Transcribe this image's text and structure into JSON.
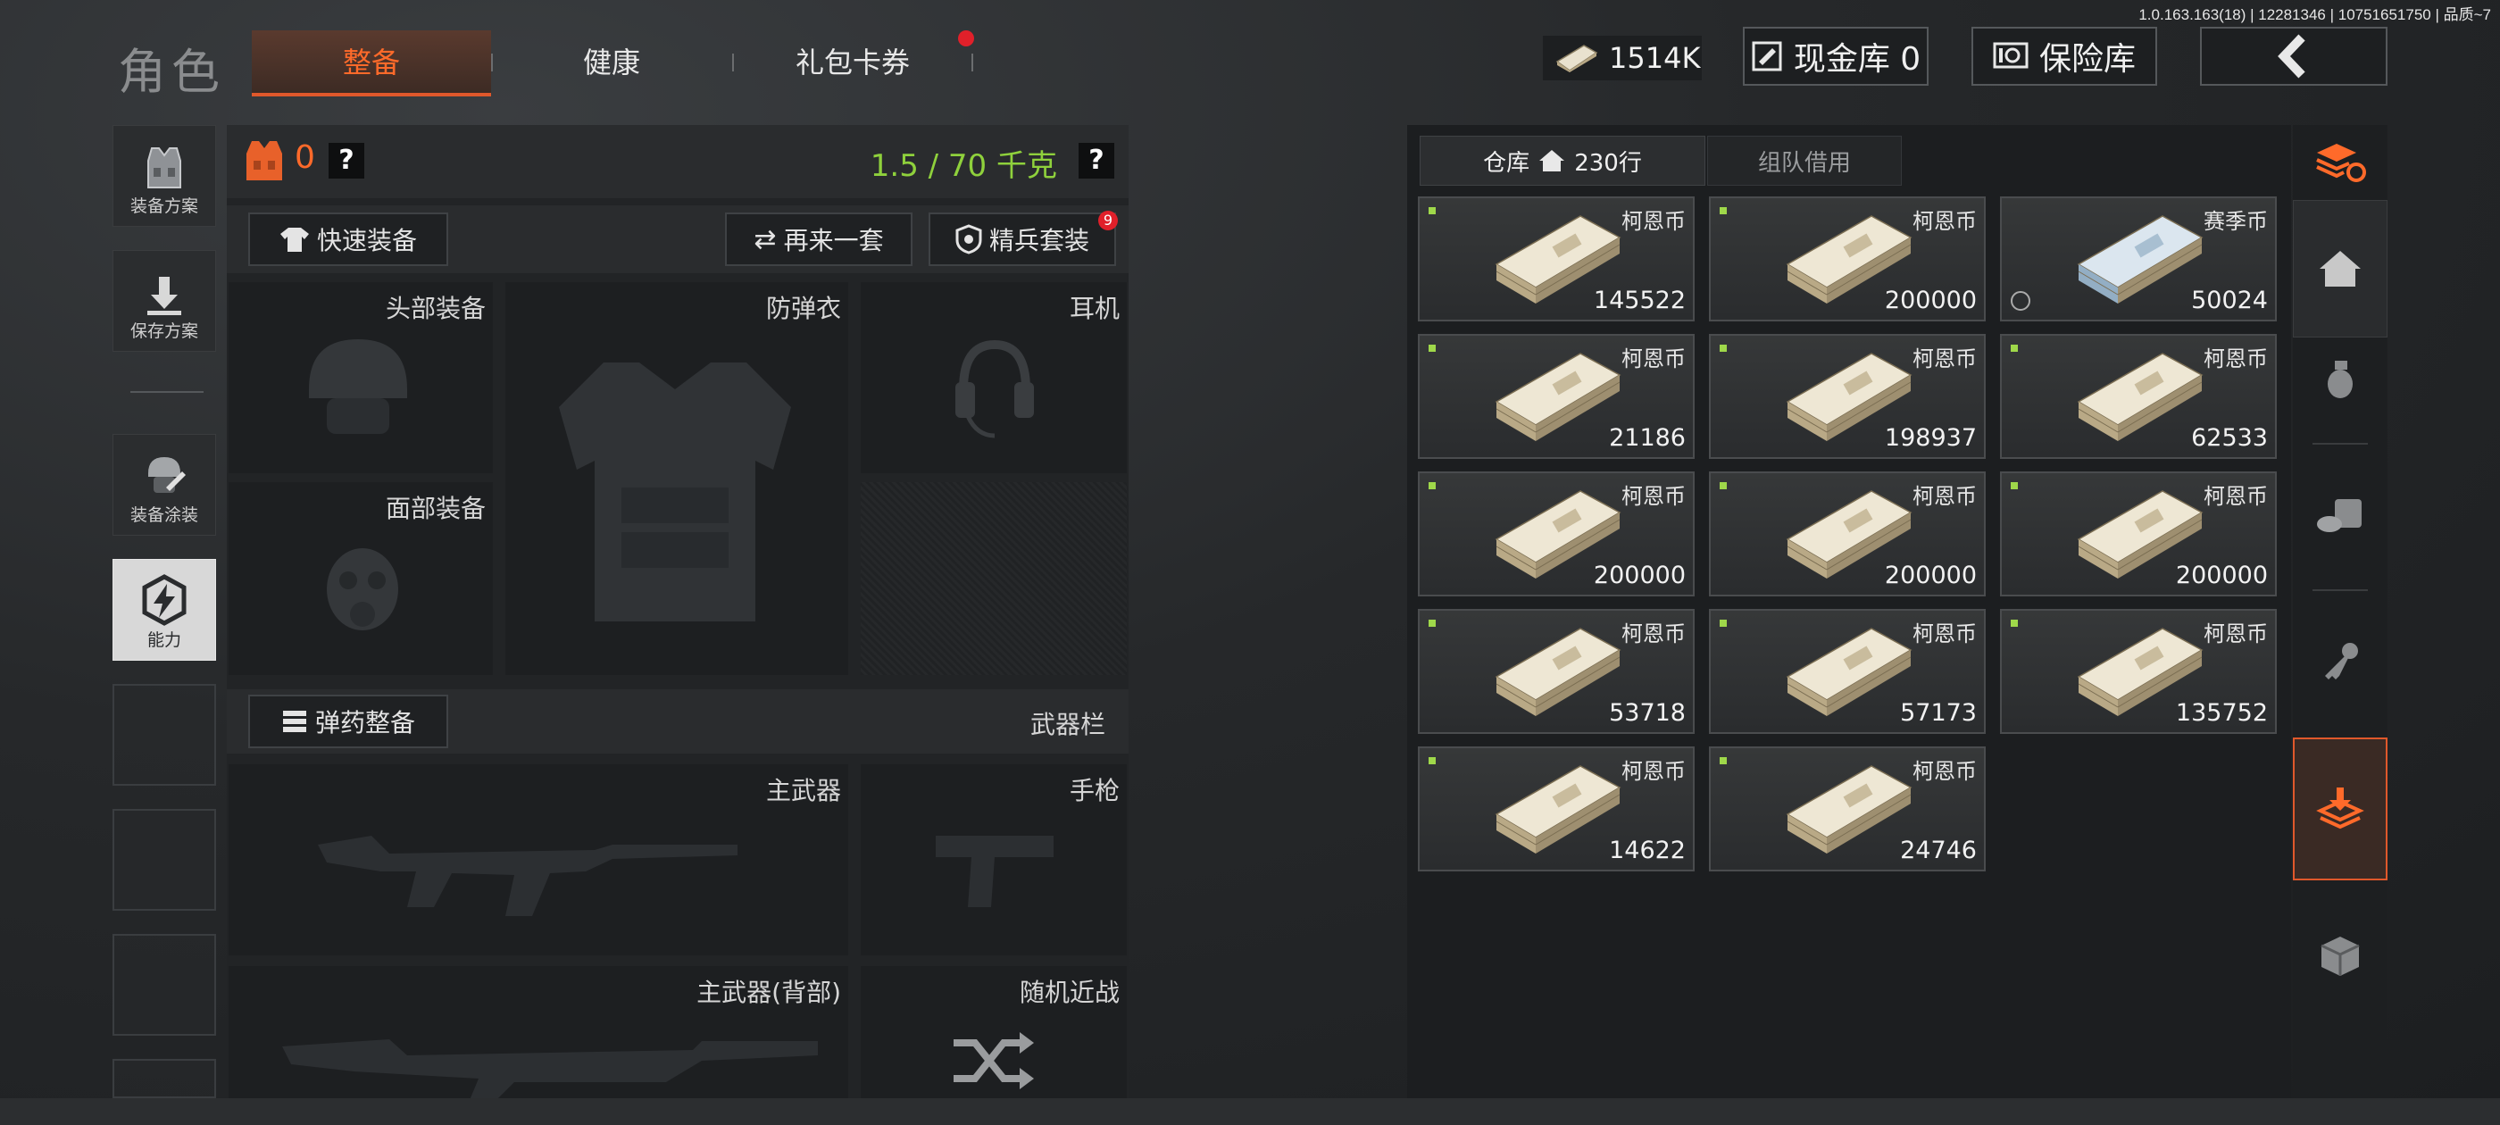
{
  "version_text": "1.0.163.163(18) | 12281346 | 10751651750 | 品质~7",
  "header": {
    "title": "角色",
    "tabs": [
      {
        "label": "整备"
      },
      {
        "label": "健康"
      },
      {
        "label": "礼包卡券"
      }
    ],
    "currency": "1514K",
    "cash_vault": "现金库 0",
    "safe_box": "保险库"
  },
  "sidebar": {
    "items": [
      {
        "label": "装备方案"
      },
      {
        "label": "保存方案"
      },
      {
        "label": "装备涂装"
      },
      {
        "label": "能力"
      }
    ]
  },
  "loadout": {
    "armor_count": "0",
    "weight": "1.5 / 70 千克",
    "help": "?",
    "quick_equip": "快速装备",
    "redo": "再来一套",
    "elite_kit": "精兵套装",
    "elite_badge": "9",
    "slots": {
      "head": "头部装备",
      "armor": "防弹衣",
      "headset": "耳机",
      "face": "面部装备"
    },
    "ammo_equip": "弹药整备",
    "weapon_bar": "武器栏",
    "weapons": {
      "primary": "主武器",
      "pistol": "手枪",
      "primary_back": "主武器(背部)",
      "melee": "随机近战"
    }
  },
  "stash": {
    "tab_warehouse": "仓库",
    "rows": "230行",
    "tab_team": "组队借用",
    "items": [
      {
        "name": "柯恩币",
        "count": "145522",
        "type": "coin"
      },
      {
        "name": "柯恩币",
        "count": "200000",
        "type": "coin"
      },
      {
        "name": "赛季币",
        "count": "50024",
        "type": "season"
      },
      {
        "name": "柯恩币",
        "count": "21186",
        "type": "coin"
      },
      {
        "name": "柯恩币",
        "count": "198937",
        "type": "coin"
      },
      {
        "name": "柯恩币",
        "count": "62533",
        "type": "coin"
      },
      {
        "name": "柯恩币",
        "count": "200000",
        "type": "coin"
      },
      {
        "name": "柯恩币",
        "count": "200000",
        "type": "coin"
      },
      {
        "name": "柯恩币",
        "count": "200000",
        "type": "coin"
      },
      {
        "name": "柯恩币",
        "count": "53718",
        "type": "coin"
      },
      {
        "name": "柯恩币",
        "count": "57173",
        "type": "coin"
      },
      {
        "name": "柯恩币",
        "count": "135752",
        "type": "coin"
      },
      {
        "name": "柯恩币",
        "count": "14622",
        "type": "coin"
      },
      {
        "name": "柯恩币",
        "count": "24746",
        "type": "coin"
      }
    ]
  },
  "colors": {
    "accent": "#ff6a2a",
    "weight": "#8fd13c",
    "badge": "#e0202a"
  }
}
